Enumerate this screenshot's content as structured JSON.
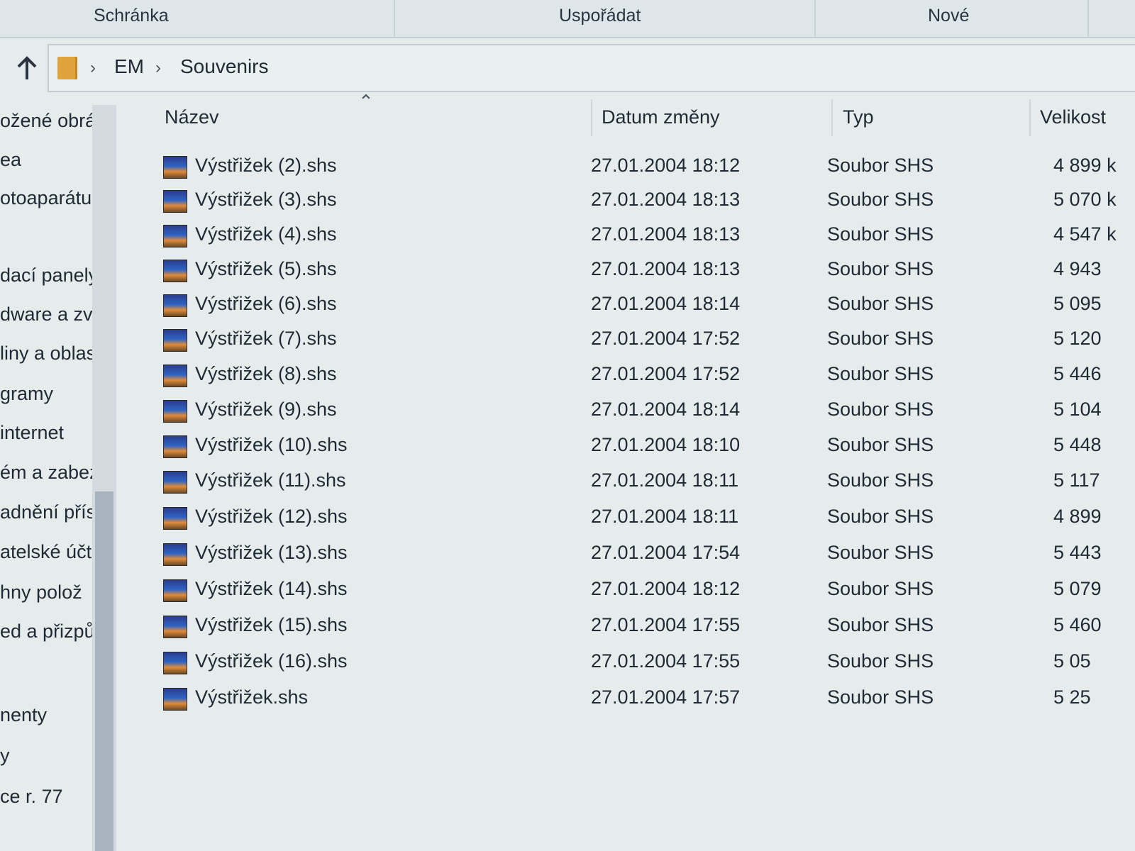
{
  "ribbon": {
    "groups": [
      "Schránka",
      "Uspořádat",
      "Nové"
    ]
  },
  "address": {
    "crumbs": [
      "EM",
      "Souvenirs"
    ]
  },
  "nav": {
    "items": [
      "ožené obrázk",
      "ea",
      "otoaparátu",
      "dací panely",
      "dware a zvu",
      "liny a oblas",
      "gramy",
      "internet",
      "ém a zabez",
      "adnění přís",
      "atelské účt",
      "hny polož",
      "ed a přizpů",
      "nenty",
      "y",
      "ce r. 77"
    ]
  },
  "columns": {
    "name": "Název",
    "date": "Datum změny",
    "type": "Typ",
    "size": "Velikost"
  },
  "files": [
    {
      "name": "Výstřižek (2).shs",
      "date": "27.01.2004 18:12",
      "type": "Soubor SHS",
      "size": "4 899 k"
    },
    {
      "name": "Výstřižek (3).shs",
      "date": "27.01.2004 18:13",
      "type": "Soubor SHS",
      "size": "5 070 k"
    },
    {
      "name": "Výstřižek (4).shs",
      "date": "27.01.2004 18:13",
      "type": "Soubor SHS",
      "size": "4 547 k"
    },
    {
      "name": "Výstřižek (5).shs",
      "date": "27.01.2004 18:13",
      "type": "Soubor SHS",
      "size": "4 943"
    },
    {
      "name": "Výstřižek (6).shs",
      "date": "27.01.2004 18:14",
      "type": "Soubor SHS",
      "size": "5 095"
    },
    {
      "name": "Výstřižek (7).shs",
      "date": "27.01.2004 17:52",
      "type": "Soubor SHS",
      "size": "5 120"
    },
    {
      "name": "Výstřižek (8).shs",
      "date": "27.01.2004 17:52",
      "type": "Soubor SHS",
      "size": "5 446"
    },
    {
      "name": "Výstřižek (9).shs",
      "date": "27.01.2004 18:14",
      "type": "Soubor SHS",
      "size": "5 104"
    },
    {
      "name": "Výstřižek (10).shs",
      "date": "27.01.2004 18:10",
      "type": "Soubor SHS",
      "size": "5 448"
    },
    {
      "name": "Výstřižek (11).shs",
      "date": "27.01.2004 18:11",
      "type": "Soubor SHS",
      "size": "5 117"
    },
    {
      "name": "Výstřižek (12).shs",
      "date": "27.01.2004 18:11",
      "type": "Soubor SHS",
      "size": "4 899"
    },
    {
      "name": "Výstřižek (13).shs",
      "date": "27.01.2004 17:54",
      "type": "Soubor SHS",
      "size": "5 443"
    },
    {
      "name": "Výstřižek (14).shs",
      "date": "27.01.2004 18:12",
      "type": "Soubor SHS",
      "size": "5 079"
    },
    {
      "name": "Výstřižek (15).shs",
      "date": "27.01.2004 17:55",
      "type": "Soubor SHS",
      "size": "5 460"
    },
    {
      "name": "Výstřižek (16).shs",
      "date": "27.01.2004 17:55",
      "type": "Soubor SHS",
      "size": "5 05"
    },
    {
      "name": "Výstřižek.shs",
      "date": "27.01.2004 17:57",
      "type": "Soubor SHS",
      "size": "5 25"
    }
  ]
}
